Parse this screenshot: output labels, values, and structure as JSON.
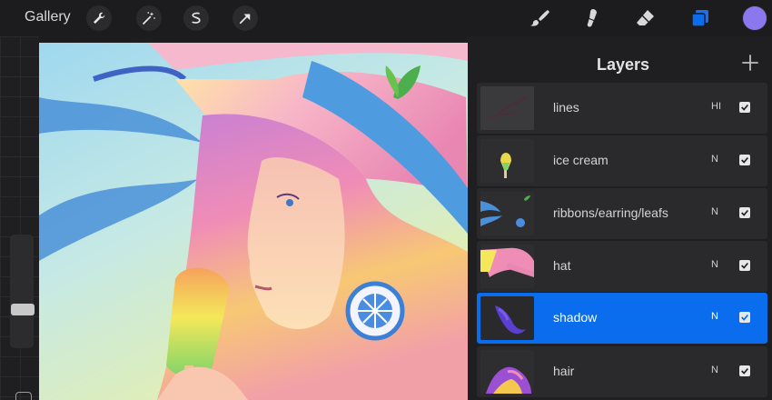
{
  "toolbar": {
    "gallery_label": "Gallery",
    "left_tools": [
      {
        "name": "wrench-icon",
        "label": "Actions"
      },
      {
        "name": "magic-wand-icon",
        "label": "Adjustments"
      },
      {
        "name": "selection-icon",
        "label": "Selection"
      },
      {
        "name": "transform-arrow-icon",
        "label": "Transform"
      }
    ],
    "right_tools": [
      {
        "name": "brush-icon"
      },
      {
        "name": "smudge-icon"
      },
      {
        "name": "eraser-icon"
      },
      {
        "name": "layers-icon",
        "active": true
      }
    ],
    "current_color": "#8b78ee"
  },
  "colors": {
    "accent": "#0a6dee",
    "background": "#1d1d1f",
    "panel": "#1f1f21",
    "row": "#2a2a2c"
  },
  "layers_panel": {
    "title": "Layers",
    "add_icon": "plus-icon",
    "layers": [
      {
        "name": "lines",
        "mode": "HI",
        "visible": true,
        "selected": false
      },
      {
        "name": "ice cream",
        "mode": "N",
        "visible": true,
        "selected": false
      },
      {
        "name": "ribbons/earring/leafs",
        "mode": "N",
        "visible": true,
        "selected": false
      },
      {
        "name": "hat",
        "mode": "N",
        "visible": true,
        "selected": false
      },
      {
        "name": "shadow",
        "mode": "N",
        "visible": true,
        "selected": true
      },
      {
        "name": "hair",
        "mode": "N",
        "visible": true,
        "selected": false
      }
    ]
  },
  "sidebar": {
    "brush_size_slider": "brush-size-slider",
    "opacity_modifier": "modify-button"
  }
}
